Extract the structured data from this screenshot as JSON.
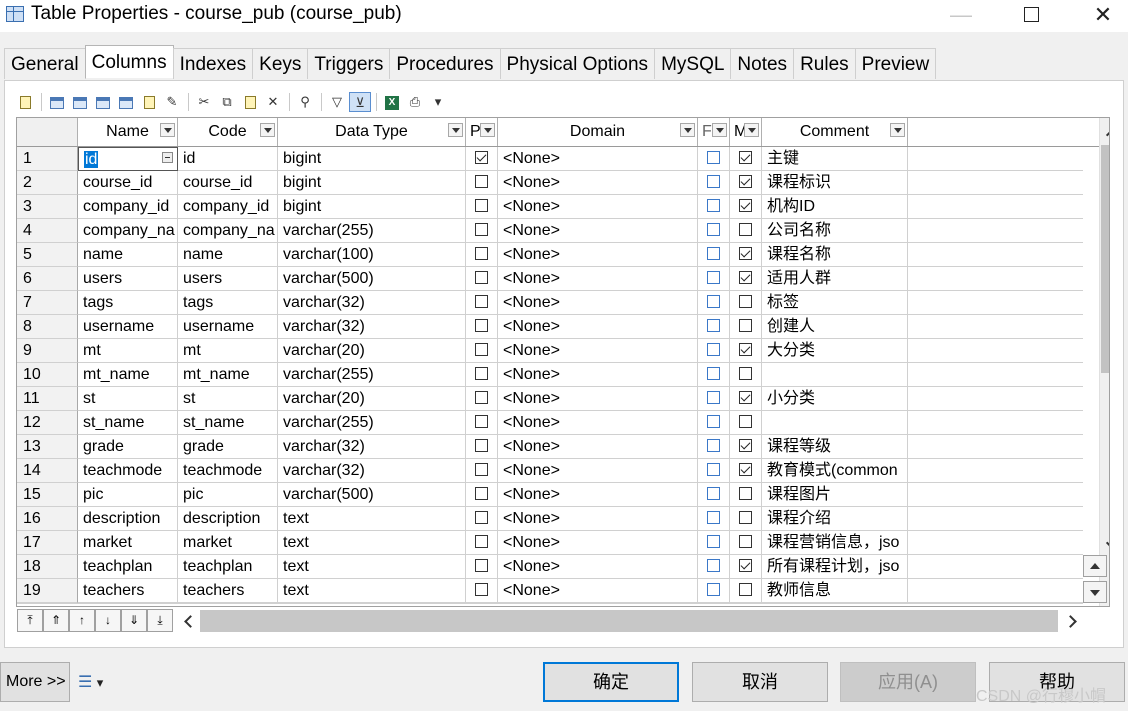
{
  "window": {
    "title": "Table Properties - course_pub (course_pub)",
    "minimize_glyph": "—",
    "close_glyph": "✕"
  },
  "tabs": [
    "General",
    "Columns",
    "Indexes",
    "Keys",
    "Triggers",
    "Procedures",
    "Physical Options",
    "MySQL",
    "Notes",
    "Rules",
    "Preview"
  ],
  "active_tab": "Columns",
  "toolbar": {
    "icons": [
      "properties-icon",
      "insert-row-icon",
      "add-row-icon",
      "add-columns-icon",
      "delete-row-icon",
      "paste-icon",
      "reuse-icon",
      "cut-icon",
      "copy-icon",
      "paste-clipboard-icon",
      "delete-icon",
      "find-icon",
      "customize-columns-icon",
      "filter-icon",
      "export-excel-icon",
      "print-icon",
      "dropdown-icon"
    ],
    "glyphs": {
      "cut": "✂",
      "copy": "⧉",
      "delete": "✕",
      "find": "⚲",
      "filter": "▽",
      "filter_active": "⊻",
      "excel": "X",
      "print": "⎙",
      "dropdown": "▾",
      "reuse": "✎"
    }
  },
  "columns_header": {
    "name": "Name",
    "code": "Code",
    "data_type": "Data Type",
    "primary": "P",
    "domain": "Domain",
    "foreign": "F",
    "mandatory": "M",
    "comment": "Comment"
  },
  "rows": [
    {
      "n": "1",
      "name": "id",
      "code": "id",
      "type": "bigint",
      "p": true,
      "domain": "<None>",
      "f": false,
      "m": true,
      "comment": "主键"
    },
    {
      "n": "2",
      "name": "course_id",
      "code": "course_id",
      "type": "bigint",
      "p": false,
      "domain": "<None>",
      "f": false,
      "m": true,
      "comment": "课程标识"
    },
    {
      "n": "3",
      "name": "company_id",
      "code": "company_id",
      "type": "bigint",
      "p": false,
      "domain": "<None>",
      "f": false,
      "m": true,
      "comment": "机构ID"
    },
    {
      "n": "4",
      "name": "company_na",
      "code": "company_na",
      "type": "varchar(255)",
      "p": false,
      "domain": "<None>",
      "f": false,
      "m": false,
      "comment": "公司名称"
    },
    {
      "n": "5",
      "name": "name",
      "code": "name",
      "type": "varchar(100)",
      "p": false,
      "domain": "<None>",
      "f": false,
      "m": true,
      "comment": "课程名称"
    },
    {
      "n": "6",
      "name": "users",
      "code": "users",
      "type": "varchar(500)",
      "p": false,
      "domain": "<None>",
      "f": false,
      "m": true,
      "comment": "适用人群"
    },
    {
      "n": "7",
      "name": "tags",
      "code": "tags",
      "type": "varchar(32)",
      "p": false,
      "domain": "<None>",
      "f": false,
      "m": false,
      "comment": "标签"
    },
    {
      "n": "8",
      "name": "username",
      "code": "username",
      "type": "varchar(32)",
      "p": false,
      "domain": "<None>",
      "f": false,
      "m": false,
      "comment": "创建人"
    },
    {
      "n": "9",
      "name": "mt",
      "code": "mt",
      "type": "varchar(20)",
      "p": false,
      "domain": "<None>",
      "f": false,
      "m": true,
      "comment": "大分类"
    },
    {
      "n": "10",
      "name": "mt_name",
      "code": "mt_name",
      "type": "varchar(255)",
      "p": false,
      "domain": "<None>",
      "f": false,
      "m": false,
      "comment": ""
    },
    {
      "n": "11",
      "name": "st",
      "code": "st",
      "type": "varchar(20)",
      "p": false,
      "domain": "<None>",
      "f": false,
      "m": true,
      "comment": "小分类"
    },
    {
      "n": "12",
      "name": "st_name",
      "code": "st_name",
      "type": "varchar(255)",
      "p": false,
      "domain": "<None>",
      "f": false,
      "m": false,
      "comment": ""
    },
    {
      "n": "13",
      "name": "grade",
      "code": "grade",
      "type": "varchar(32)",
      "p": false,
      "domain": "<None>",
      "f": false,
      "m": true,
      "comment": "课程等级"
    },
    {
      "n": "14",
      "name": "teachmode",
      "code": "teachmode",
      "type": "varchar(32)",
      "p": false,
      "domain": "<None>",
      "f": false,
      "m": true,
      "comment": "教育模式(common"
    },
    {
      "n": "15",
      "name": "pic",
      "code": "pic",
      "type": "varchar(500)",
      "p": false,
      "domain": "<None>",
      "f": false,
      "m": false,
      "comment": "课程图片"
    },
    {
      "n": "16",
      "name": "description",
      "code": "description",
      "type": "text",
      "p": false,
      "domain": "<None>",
      "f": false,
      "m": false,
      "comment": "课程介绍"
    },
    {
      "n": "17",
      "name": "market",
      "code": "market",
      "type": "text",
      "p": false,
      "domain": "<None>",
      "f": false,
      "m": false,
      "comment": "课程营销信息，jso"
    },
    {
      "n": "18",
      "name": "teachplan",
      "code": "teachplan",
      "type": "text",
      "p": false,
      "domain": "<None>",
      "f": false,
      "m": true,
      "comment": "所有课程计划，jso"
    },
    {
      "n": "19",
      "name": "teachers",
      "code": "teachers",
      "type": "text",
      "p": false,
      "domain": "<None>",
      "f": false,
      "m": false,
      "comment": "教师信息"
    }
  ],
  "navigation": {
    "glyphs": {
      "first": "⤒",
      "page_up": "⇑",
      "prev": "↑",
      "next": "↓",
      "page_down": "⇓",
      "last": "⤓"
    }
  },
  "footer": {
    "more_label": "More >>",
    "options_glyph": "☰",
    "options_dropdown_glyph": "▾",
    "ok_label": "确定",
    "cancel_label": "取消",
    "apply_label": "应用(A)",
    "help_label": "帮助",
    "watermark": "CSDN @行穆小帽"
  },
  "colors": {
    "accent": "#0078d7",
    "foreign_checkbox": "#3b78c8"
  }
}
